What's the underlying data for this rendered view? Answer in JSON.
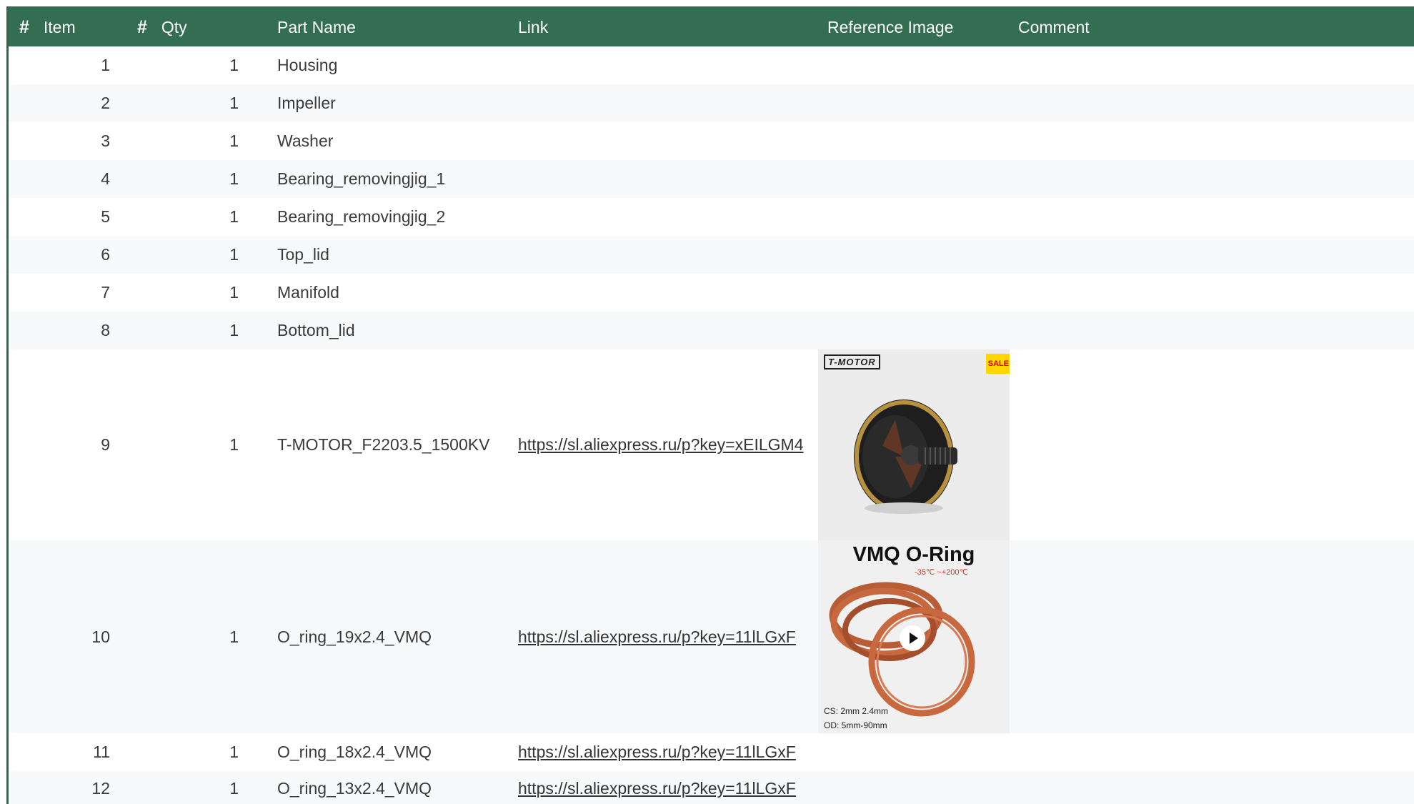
{
  "headers": {
    "item": "Item",
    "qty": "Qty",
    "part_name": "Part Name",
    "link": "Link",
    "reference_image": "Reference Image",
    "comment": "Comment",
    "hash": "#"
  },
  "rows": [
    {
      "item": "1",
      "qty": "1",
      "part": "Housing",
      "link": ""
    },
    {
      "item": "2",
      "qty": "1",
      "part": "Impeller",
      "link": ""
    },
    {
      "item": "3",
      "qty": "1",
      "part": "Washer",
      "link": ""
    },
    {
      "item": "4",
      "qty": "1",
      "part": "Bearing_removingjig_1",
      "link": ""
    },
    {
      "item": "5",
      "qty": "1",
      "part": "Bearing_removingjig_2",
      "link": ""
    },
    {
      "item": "6",
      "qty": "1",
      "part": "Top_lid",
      "link": ""
    },
    {
      "item": "7",
      "qty": "1",
      "part": "Manifold",
      "link": ""
    },
    {
      "item": "8",
      "qty": "1",
      "part": "Bottom_lid",
      "link": ""
    },
    {
      "item": "9",
      "qty": "1",
      "part": "T-MOTOR_F2203.5_1500KV",
      "link": "https://sl.aliexpress.ru/p?key=xEILGM4"
    },
    {
      "item": "10",
      "qty": "1",
      "part": "O_ring_19x2.4_VMQ",
      "link": "https://sl.aliexpress.ru/p?key=11lLGxF"
    },
    {
      "item": "11",
      "qty": "1",
      "part": "O_ring_18x2.4_VMQ",
      "link": "https://sl.aliexpress.ru/p?key=11lLGxF"
    },
    {
      "item": "12",
      "qty": "1",
      "part": "O_ring_13x2.4_VMQ",
      "link": "https://sl.aliexpress.ru/p?key=11lLGxF"
    }
  ],
  "images": {
    "tmotor": {
      "brand": "T-MOTOR",
      "badge": "SALE"
    },
    "oring": {
      "title": "VMQ  O-Ring",
      "temp": "-35℃ ~+200℃",
      "cs": "CS:  2mm 2.4mm",
      "od": "OD:  5mm-90mm"
    }
  },
  "colors": {
    "header_bg": "#346e52",
    "header_text": "#ffffff",
    "ring": "#c8683f"
  }
}
